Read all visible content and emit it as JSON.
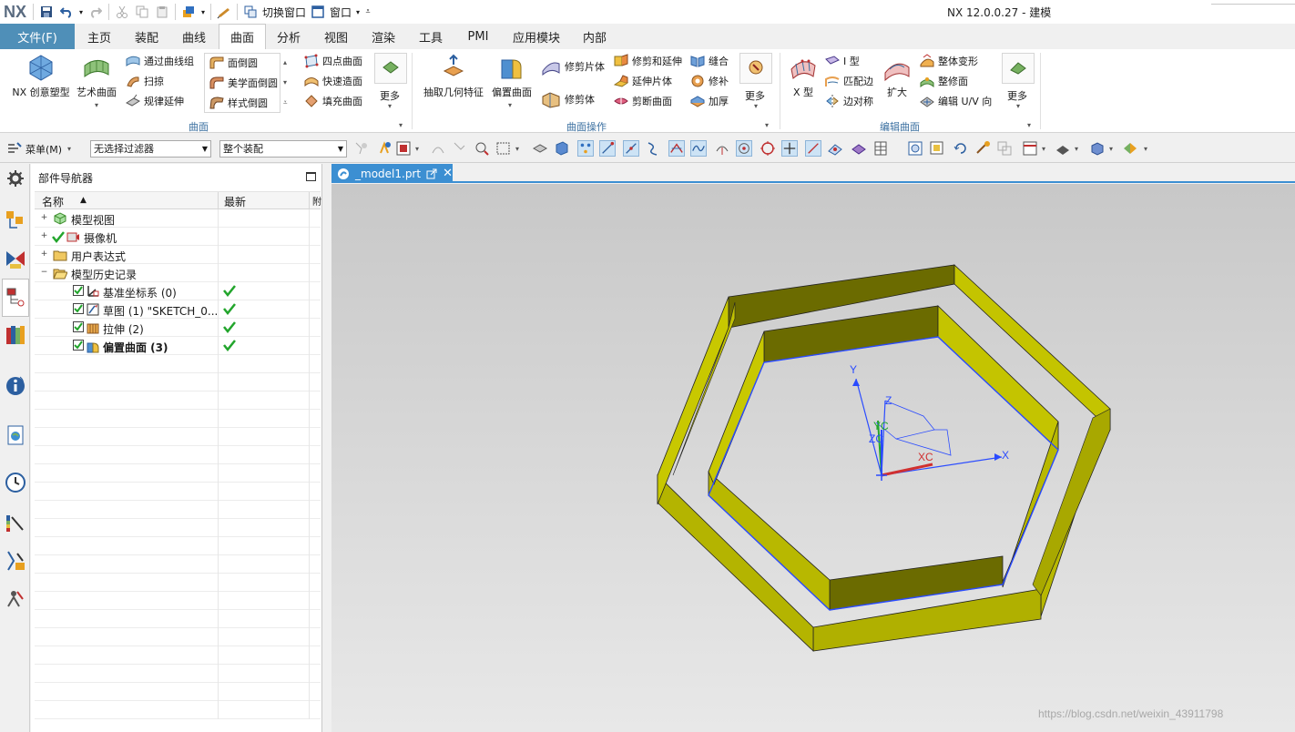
{
  "app": {
    "logo": "NX",
    "title": "NX 12.0.0.27 - 建模",
    "switch_window": "切换窗口",
    "window_menu": "窗口"
  },
  "menu": {
    "file": "文件(F)",
    "tabs": [
      "主页",
      "装配",
      "曲线",
      "曲面",
      "分析",
      "视图",
      "渲染",
      "工具",
      "PMI",
      "应用模块",
      "内部"
    ],
    "active_tab": "曲面"
  },
  "ribbon": {
    "surface_group": {
      "label": "曲面",
      "nx_realize": "NX 创意塑型",
      "studio_surface": "艺术曲面",
      "through_curve_mesh": "通过曲线组",
      "swept": "扫掠",
      "law_extension": "规律延伸",
      "face_blend": "面倒圆",
      "aesthetic_face_blend": "美学面倒圆",
      "styled_blend": "样式倒圆",
      "four_point_surface": "四点曲面",
      "rapid_surfacing": "快速造面",
      "fill_surface": "填充曲面",
      "more": "更多"
    },
    "surface_ops_group": {
      "label": "曲面操作",
      "extract_geometry": "抽取几何特征",
      "offset_surface": "偏置曲面",
      "trimmed_sheet": "修剪片体",
      "trim_body": "修剪体",
      "trim_and_extend": "修剪和延伸",
      "extend_sheet": "延伸片体",
      "divide_face": "剪断曲面",
      "sew": "缝合",
      "patch": "修补",
      "thicken": "加厚",
      "more": "更多"
    },
    "edit_surface_group": {
      "label": "编辑曲面",
      "x_form": "X 型",
      "i_form": "I 型",
      "match_edge": "匹配边",
      "edge_symmetry": "边对称",
      "enlarge": "扩大",
      "global_shaping": "整体变形",
      "refit_face": "整修面",
      "edit_uv": "编辑 U/V 向",
      "more": "更多"
    }
  },
  "selection_bar": {
    "menu": "菜单(M)",
    "filter": "无选择过滤器",
    "scope": "整个装配"
  },
  "navigator": {
    "title": "部件导航器",
    "col_name": "名称",
    "col_latest": "最新",
    "col_third": "附",
    "items": [
      {
        "label": "模型视图",
        "level": 0,
        "bold": false
      },
      {
        "label": "摄像机",
        "level": 0,
        "bold": false
      },
      {
        "label": "用户表达式",
        "level": 0,
        "bold": false
      },
      {
        "label": "模型历史记录",
        "level": 0,
        "bold": false
      },
      {
        "label": "基准坐标系 (0)",
        "level": 1,
        "bold": false,
        "latest": true
      },
      {
        "label": "草图 (1) \"SKETCH_0...",
        "level": 1,
        "bold": false,
        "latest": true
      },
      {
        "label": "拉伸 (2)",
        "level": 1,
        "bold": false,
        "latest": true
      },
      {
        "label": "偏置曲面 (3)",
        "level": 1,
        "bold": true,
        "latest": true
      }
    ]
  },
  "document": {
    "tab": "_model1.prt"
  },
  "viewport": {
    "axis_x": "X",
    "axis_y": "Y",
    "axis_z": "Z",
    "axis_xc": "XC",
    "axis_yc": "YC",
    "axis_zc": "ZC",
    "watermark": "https://blog.csdn.net/weixin_43911798"
  },
  "colors": {
    "accent": "#4f8fb8",
    "doc_tab": "#3c8fd2",
    "model_top": "#6b6b00",
    "model_face": "#b8b800",
    "edge_blue": "#2a4bff",
    "check_green": "#22a52c"
  }
}
